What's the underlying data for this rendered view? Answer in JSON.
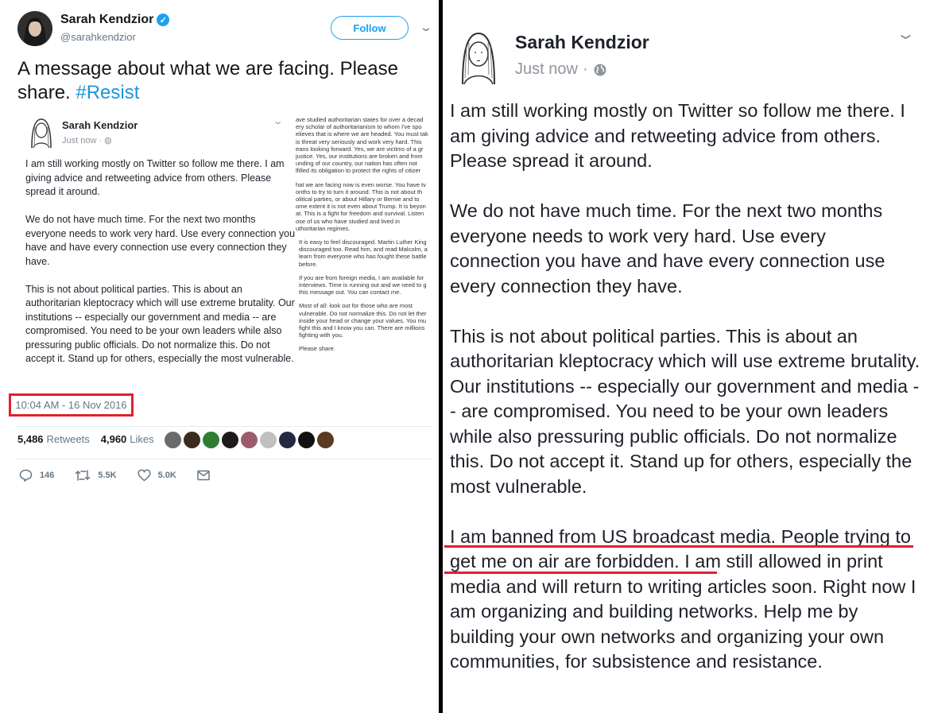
{
  "tweet": {
    "author_name": "Sarah Kendzior",
    "handle": "@sarahkendzior",
    "follow_label": "Follow",
    "chevron": "⌄",
    "text": "A message about what we are facing. Please share.",
    "hashtag": "#Resist",
    "timestamp": "10:04 AM - 16 Nov 2016",
    "retweets_count": "5,486",
    "retweets_label": "Retweets",
    "likes_count": "4,960",
    "likes_label": "Likes",
    "liker_colors": [
      "#6a6a6a",
      "#3a2a20",
      "#2e7d32",
      "#1f1a1a",
      "#9c5b6b",
      "#c0c0c0",
      "#222a44",
      "#111111",
      "#5a3a20"
    ],
    "reply_count": "146",
    "retweet_count_short": "5.5K",
    "like_count_short": "5.0K",
    "icons": [
      "reply-icon",
      "retweet-icon",
      "like-icon",
      "message-icon"
    ]
  },
  "embed": {
    "name": "Sarah Kendzior",
    "meta": "Just now · ◍",
    "chevron": "⌄",
    "para1": "I am still working mostly on Twitter so follow me there. I am giving advice and retweeting advice from others. Please spread it around.",
    "para2": "We do not have much time. For the next two months everyone needs to work very hard. Use every connection you have and have every connection use every connection they have.",
    "para3": "This is not about political parties. This is about an authoritarian kleptocracy which will use extreme brutality. Our institutions -- especially our government and media -- are compromised. You need to be your own leaders while also pressuring public officials. Do not normalize this. Do not accept it. Stand up for others, especially the most vulnerable.",
    "col2_lines_a": [
      "ave studied authoritarian states for over a decad",
      "ery scholar of authoritarianism to whom I've spo",
      "elieves that is where we are headed. You must tak",
      "is threat very seriously and work very hard. This",
      "eans looking forward. Yes, we are victims of a gr",
      "justice. Yes, our institutions are broken and from",
      "unding of our country, our nation has often not",
      "lfilled its obligation to protect the rights of citizer"
    ],
    "col2_lines_b": [
      "hat we are facing now is even worse. You have tv",
      "onths to try to turn it around. This is not about th",
      "olitical parties, or about Hillary or Bernie and to",
      "ome extent it is not even about Trump. It is beyon",
      "at. This is a fight for freedom and survival. Listen",
      "ose of us who have studied and lived in",
      "uthoritarian regimes."
    ],
    "col2_lines_c": [
      "It is easy to feel discouraged. Martin Luther King",
      "discouraged too. Read him, and read Malcolm, a",
      "learn from everyone who has fought these battle",
      "before."
    ],
    "col2_lines_d": [
      "If you are from foreign media, I am available for",
      "interviews. Time is running out and we need to g",
      "this message out. You can contact me."
    ],
    "col2_lines_e": [
      "Most of all: look out for those who are most",
      "vulnerable. Do not normalize this. Do not let ther",
      "inside your head or change your values. You mu",
      "fight this and I know you can. There are millions",
      "fighting with you."
    ],
    "col2_lines_f": [
      "Please share."
    ]
  },
  "post": {
    "name": "Sarah Kendzior",
    "time": "Just now",
    "dot": "·",
    "chevron": "⌄",
    "para1": "I am still working mostly on Twitter so follow me there. I am giving advice and retweeting advice from others. Please spread it around.",
    "para2": "We do not have much time. For the next two months everyone needs to work very hard. Use every connection you have and have every connection use every connection they have.",
    "para3": "This is not about political parties. This is about an authoritarian kleptocracy which will use extreme brutality. Our institutions -- especially our government and media -- are compromised. You need to be your own leaders while also pressuring public officials. Do not normalize this. Do not accept it. Stand up for others, especially the most vulnerable.",
    "para4": "I am banned from US broadcast media. People trying to get me on air are forbidden. I am still allowed in print media and will return to writing articles soon. Right now I am organizing and building networks. Help me by building your own networks and organizing your own communities, for subsistence and resistance."
  },
  "colors": {
    "twitter_blue": "#1da1f2",
    "highlight_red": "#e0202e",
    "text_dark": "#14171a",
    "text_gray": "#657786"
  }
}
